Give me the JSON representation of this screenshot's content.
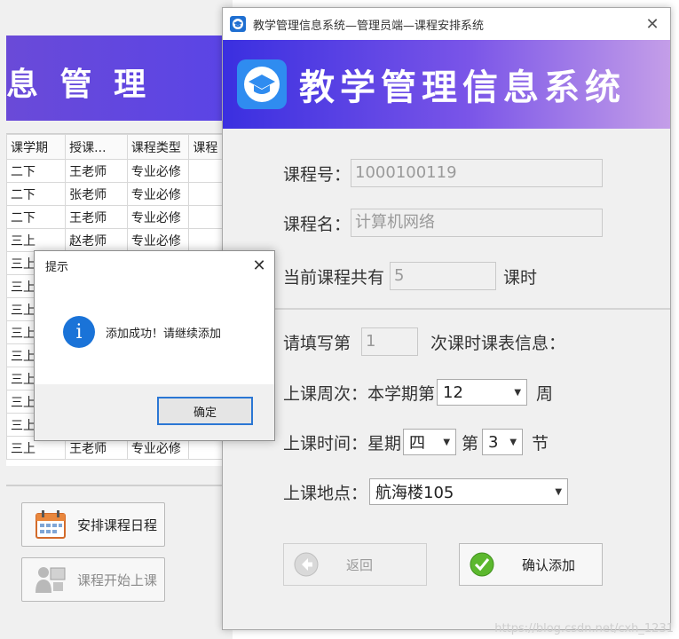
{
  "background_window": {
    "banner_text": "息 管 理",
    "table": {
      "headers": [
        "课学期",
        "授课...",
        "课程类型",
        "课程"
      ],
      "rows": [
        [
          "二下",
          "王老师",
          "专业必修"
        ],
        [
          "二下",
          "张老师",
          "专业必修"
        ],
        [
          "二下",
          "王老师",
          "专业必修"
        ],
        [
          "三上",
          "赵老师",
          "专业必修"
        ],
        [
          "三上",
          "",
          ""
        ],
        [
          "三上",
          "",
          ""
        ],
        [
          "三上",
          "",
          ""
        ],
        [
          "三上",
          "",
          ""
        ],
        [
          "三上",
          "",
          ""
        ],
        [
          "三上",
          "",
          ""
        ],
        [
          "三上",
          "",
          ""
        ],
        [
          "三上",
          "",
          ""
        ],
        [
          "三上",
          "王老师",
          "专业必修"
        ]
      ]
    },
    "buttons": {
      "schedule": "安排课程日程",
      "start_class": "课程开始上课"
    }
  },
  "main_window": {
    "title": "教学管理信息系统—管理员端—课程安排系统",
    "close_glyph": "✕",
    "banner_title": "教学管理信息系统",
    "course_no_label": "课程号：",
    "course_no_value": "1000100119",
    "course_name_label": "课程名：",
    "course_name_value": "计算机网络",
    "total_prefix": "当前课程共有",
    "total_value": "5",
    "total_suffix": "课时",
    "fill_prefix": "请填写第",
    "fill_value": "1",
    "fill_suffix": "次课时课表信息：",
    "week_label": "上课周次：本学期第",
    "week_value": "12",
    "week_suffix": "周",
    "time_label": "上课时间：星期",
    "weekday_value": "四",
    "period_prefix": "第",
    "period_value": "3",
    "period_suffix": "节",
    "place_label": "上课地点：",
    "place_value": "航海楼105",
    "back_label": "返回",
    "confirm_label": "确认添加"
  },
  "message_box": {
    "title": "提示",
    "close_glyph": "✕",
    "message": "添加成功！请继续添加",
    "info_glyph": "i",
    "ok_label": "确定"
  },
  "watermark": "https://blog.csdn.net/cxh_1231",
  "colors": {
    "banner_start": "#3a2fe0",
    "banner_end": "#c49ee8",
    "info_blue": "#1a73d8",
    "focus_border": "#2b77d4",
    "confirm_green": "#5cb82e"
  }
}
